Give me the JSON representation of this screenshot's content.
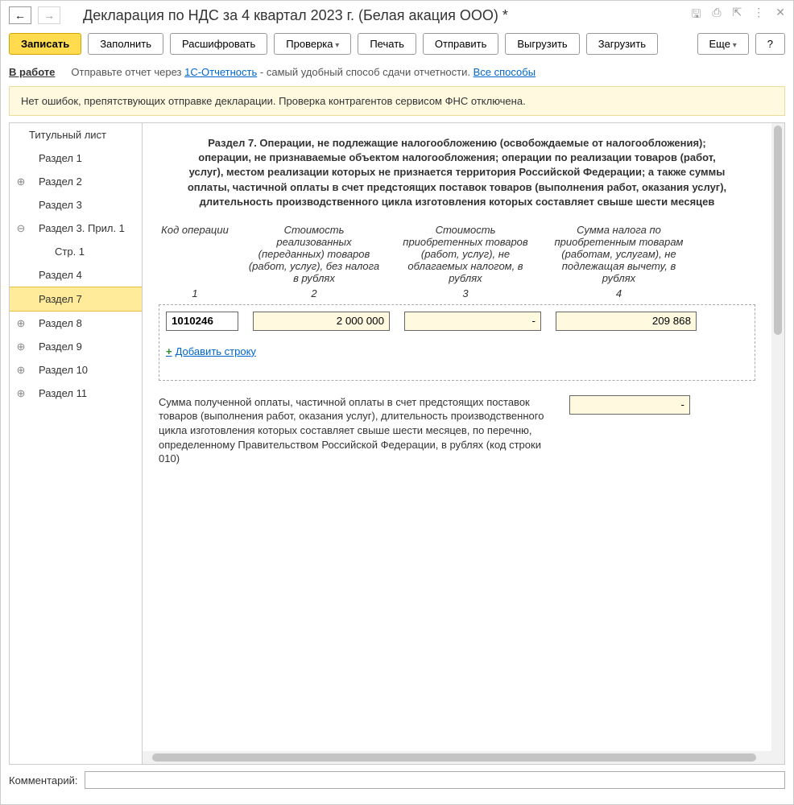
{
  "title": "Декларация по НДС за 4 квартал 2023 г. (Белая акация ООО) *",
  "nav": {
    "back": "←",
    "forward": "→"
  },
  "toolbar": {
    "write": "Записать",
    "fill": "Заполнить",
    "decrypt": "Расшифровать",
    "check": "Проверка",
    "print": "Печать",
    "send": "Отправить",
    "upload": "Выгрузить",
    "download": "Загрузить",
    "more": "Еще",
    "help": "?"
  },
  "status": {
    "label": "В работе",
    "text_prefix": "Отправьте отчет через ",
    "link1": "1С-Отчетность",
    "text_mid": " - самый удобный способ сдачи отчетности. ",
    "link2": "Все способы"
  },
  "banner": "Нет ошибок, препятствующих отправке декларации. Проверка контрагентов сервисом ФНС отключена.",
  "sidebar": {
    "items": [
      {
        "label": "Титульный лист",
        "expander": ""
      },
      {
        "label": "Раздел 1",
        "expander": ""
      },
      {
        "label": "Раздел 2",
        "expander": "⊕"
      },
      {
        "label": "Раздел 3",
        "expander": ""
      },
      {
        "label": "Раздел 3. Прил. 1",
        "expander": "⊖"
      },
      {
        "label": "Стр. 1",
        "expander": "",
        "sub": true
      },
      {
        "label": "Раздел 4",
        "expander": ""
      },
      {
        "label": "Раздел 7",
        "expander": "",
        "selected": true
      },
      {
        "label": "Раздел 8",
        "expander": "⊕"
      },
      {
        "label": "Раздел 9",
        "expander": "⊕"
      },
      {
        "label": "Раздел 10",
        "expander": "⊕"
      },
      {
        "label": "Раздел 11",
        "expander": "⊕"
      }
    ]
  },
  "section": {
    "title": "Раздел 7. Операции, не подлежащие налогообложению (освобождаемые от налогообложения); операции, не признаваемые объектом налогообложения; операции по реализации товаров (работ, услуг), местом реализации которых не признается территория Российской Федерации; а также суммы оплаты, частичной оплаты в счет предстоящих поставок товаров (выполнения работ, оказания услуг), длительность производственного цикла изготовления которых составляет свыше шести месяцев",
    "headers": {
      "c1": "Код операции",
      "c2": "Стоимость реализованных (переданных) товаров (работ, услуг), без налога в рублях",
      "c3": "Стоимость приобретенных товаров (работ, услуг), не облагаемых налогом, в рублях",
      "c4": "Сумма налога по приобретенным товарам (работам, услугам), не подлежащая вычету, в рублях"
    },
    "nums": {
      "n1": "1",
      "n2": "2",
      "n3": "3",
      "n4": "4"
    },
    "row": {
      "code": "1010246",
      "v2": "2 000 000",
      "v3": "-",
      "v4": "209 868"
    },
    "add": "Добавить строку",
    "bottom_text": "Сумма полученной оплаты, частичной оплаты в счет предстоящих поставок товаров (выполнения работ, оказания услуг), длительность производственного цикла изготовления которых составляет свыше шести месяцев, по перечню, определенному Правительством Российской Федерации, в рублях (код строки 010)",
    "bottom_value": "-"
  },
  "comment_label": "Комментарий:"
}
